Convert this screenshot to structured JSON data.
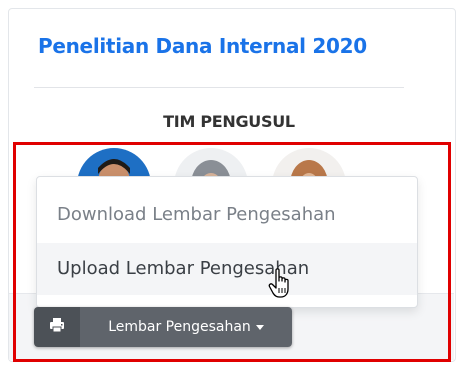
{
  "card": {
    "title": "Penelitian Dana Internal 2020",
    "team_label": "TIM PENGUSUL"
  },
  "dropdown": {
    "items": [
      {
        "label": "Download Lembar Pengesahan"
      },
      {
        "label": "Upload Lembar Pengesahan"
      }
    ]
  },
  "button_group": {
    "print_icon": "printer-icon",
    "main_label": "Lembar Pengesahan",
    "caret_icon": "caret-down-icon"
  },
  "colors": {
    "title": "#1a73e8",
    "highlight_border": "#e00000",
    "button_dark": "#4c5157",
    "button": "#5f646b"
  },
  "cursor_icon": "hand-pointer-icon"
}
